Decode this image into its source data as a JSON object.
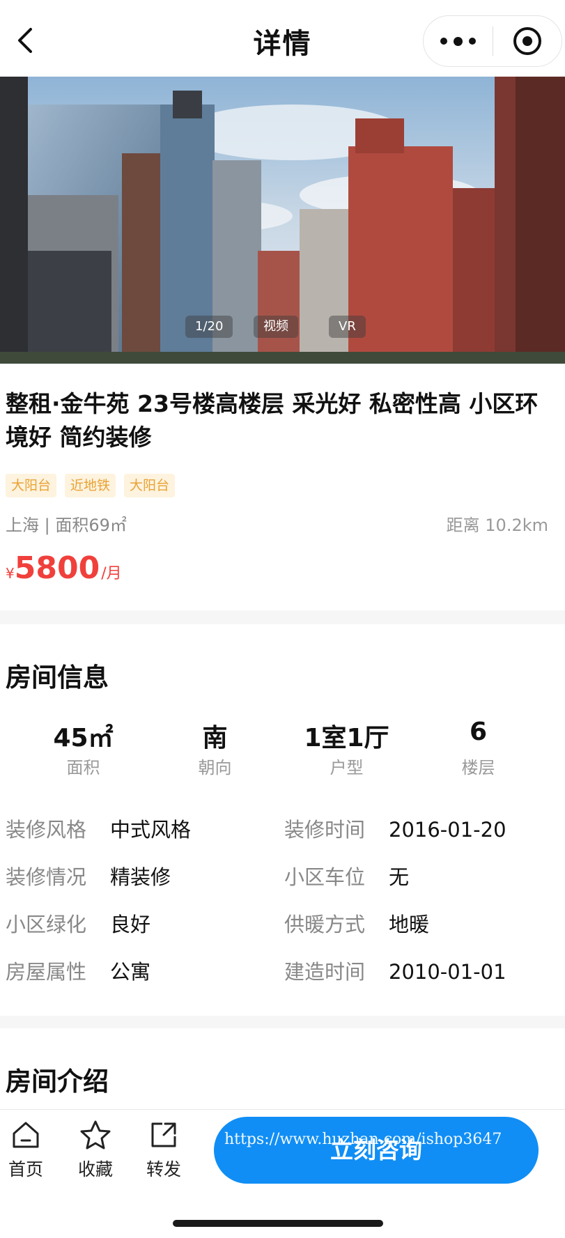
{
  "nav": {
    "title": "详情"
  },
  "gallery": {
    "counter": "1/20",
    "video_label": "视频",
    "vr_label": "VR"
  },
  "listing": {
    "title": "整租·金牛苑 23号楼高楼层 采光好 私密性高 小区环境好 简约装修",
    "tags": [
      "大阳台",
      "近地铁",
      "大阳台"
    ],
    "location_area": "上海 | 面积69㎡",
    "distance": "距离 10.2km",
    "price_currency": "¥",
    "price_value": "5800",
    "price_unit": "/月"
  },
  "room_info": {
    "title": "房间信息",
    "stats": [
      {
        "value": "45㎡",
        "label": "面积"
      },
      {
        "value": "南",
        "label": "朝向"
      },
      {
        "value": "1室1厅",
        "label": "户型"
      },
      {
        "value": "6",
        "label": "楼层"
      }
    ],
    "details": [
      {
        "key": "装修风格",
        "value": "中式风格"
      },
      {
        "key": "装修时间",
        "value": "2016-01-20"
      },
      {
        "key": "装修情况",
        "value": "精装修"
      },
      {
        "key": "小区车位",
        "value": "无"
      },
      {
        "key": "小区绿化",
        "value": "良好"
      },
      {
        "key": "供暖方式",
        "value": "地暖"
      },
      {
        "key": "房屋属性",
        "value": "公寓"
      },
      {
        "key": "建造时间",
        "value": "2010-01-01"
      }
    ]
  },
  "room_intro": {
    "title": "房间介绍"
  },
  "tabbar": {
    "home": "首页",
    "favorite": "收藏",
    "share": "转发",
    "consult": "立刻咨询",
    "watermark": "https://www.huzhan.com/ishop3647"
  },
  "colors": {
    "accent": "#108ef5",
    "price": "#f0403c",
    "tag_bg": "#fdf3df",
    "tag_text": "#e9a233"
  }
}
